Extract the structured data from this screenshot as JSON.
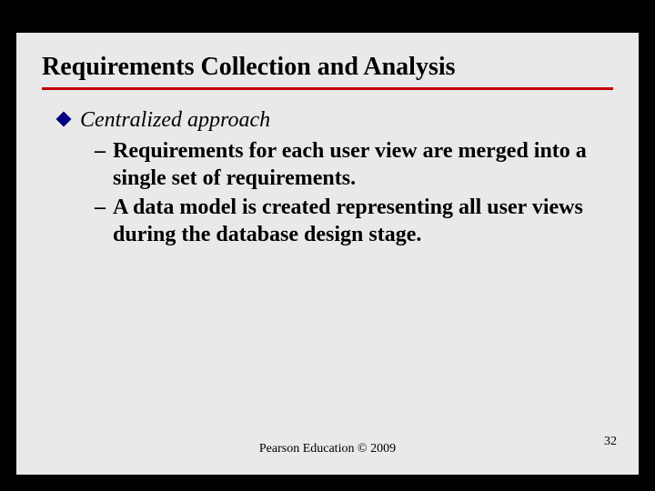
{
  "slide": {
    "title": "Requirements Collection and Analysis",
    "bullet": "Centralized approach",
    "subs": [
      "Requirements for each user view are merged into a single set of requirements.",
      "A data model is created representing all user views during the database design stage."
    ],
    "footer": "Pearson Education © 2009",
    "page": "32"
  }
}
